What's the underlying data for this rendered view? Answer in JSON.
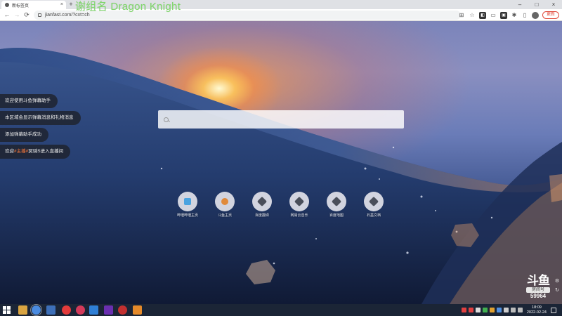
{
  "overlay_title": "谢组名 Dragon Knight",
  "browser": {
    "tab_title": "新标签页",
    "tab_close": "×",
    "new_tab": "+",
    "url": "jianfast.com/?cxt=ch",
    "update_button": "更新",
    "window_controls": {
      "minimize": "–",
      "maximize": "□",
      "close": "×"
    },
    "nav": {
      "back": "←",
      "forward": "→",
      "reload": "⟳"
    }
  },
  "chat": {
    "messages": [
      {
        "text": "欢迎使用斗鱼弹幕助手"
      },
      {
        "text": "本区域会显示弹幕消息和礼物消息"
      },
      {
        "text": "添加弹幕助手成功"
      },
      {
        "prefix": "欢迎",
        "highlight": "#主播#",
        "suffix": "冥骑S进入直播间"
      }
    ]
  },
  "search": {
    "placeholder": "",
    "value": ""
  },
  "shortcuts": [
    {
      "label": "哔哩哔哩主页",
      "color": "#4aa3e0"
    },
    {
      "label": "斗鱼主页",
      "color": "#e08a3a"
    },
    {
      "label": "百度翻译",
      "color": "#4a4f5a"
    },
    {
      "label": "网易云音乐",
      "color": "#4a4f5a"
    },
    {
      "label": "百度地图",
      "color": "#4a4f5a"
    },
    {
      "label": "石墨文档",
      "color": "#4a4f5a"
    }
  ],
  "logo": {
    "brand": "斗鱼",
    "room_label": "房间号",
    "room_number": "59964"
  },
  "clock": {
    "time": "18:09",
    "date": "2022-02-24"
  },
  "colors": {
    "accent_green": "#7fd86a",
    "highlight": "#ff7b3a",
    "taskbar": "#1b2536"
  }
}
